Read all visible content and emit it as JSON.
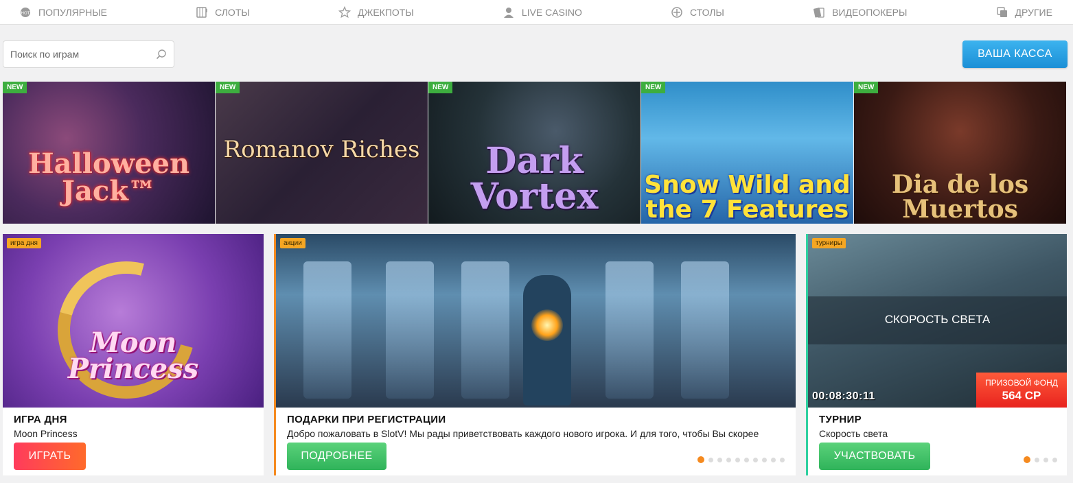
{
  "nav": {
    "items": [
      {
        "label": "ПОПУЛЯРНЫЕ",
        "icon": "hot-icon"
      },
      {
        "label": "СЛОТЫ",
        "icon": "slots-icon"
      },
      {
        "label": "ДЖЕКПОТЫ",
        "icon": "star-icon"
      },
      {
        "label": "LIVE CASINO",
        "icon": "dealer-icon"
      },
      {
        "label": "СТОЛЫ",
        "icon": "chip-icon"
      },
      {
        "label": "ВИДЕОПОКЕРЫ",
        "icon": "cards-icon"
      },
      {
        "label": "ДРУГИЕ",
        "icon": "other-icon"
      }
    ]
  },
  "search": {
    "placeholder": "Поиск по играм"
  },
  "kassa": {
    "label": "ВАША КАССА"
  },
  "games": [
    {
      "badge": "NEW",
      "title": "Halloween Jack™"
    },
    {
      "badge": "NEW",
      "title": "Romanov Riches"
    },
    {
      "badge": "NEW",
      "title": "Dark Vortex"
    },
    {
      "badge": "NEW",
      "title": "Snow Wild and the 7 Features"
    },
    {
      "badge": "NEW",
      "title": "Dia de los Muertos"
    }
  ],
  "game_of_day": {
    "tag": "игра дня",
    "image_title": "Moon Princess",
    "title": "ИГРА ДНЯ",
    "subtitle": "Moon Princess",
    "button": "ИГРАТЬ"
  },
  "promo": {
    "tag": "акции",
    "title": "ПОДАРКИ ПРИ РЕГИСТРАЦИИ",
    "subtitle": "Добро пожаловать в SlotV! Мы рады приветствовать каждого нового игрока. И для того, чтобы Вы скорее",
    "button": "ПОДРОБНЕЕ",
    "dots_total": 10,
    "dots_active": 0
  },
  "tournament": {
    "tag": "турниры",
    "overlay_title": "СКОРОСТЬ СВЕТА",
    "timer": "00:08:30:11",
    "prize_label": "ПРИЗОВОЙ ФОНД",
    "prize_value": "564 СР",
    "title": "ТУРНИР",
    "subtitle": "Скорость света",
    "button": "УЧАСТВОВАТЬ",
    "dots_total": 4,
    "dots_active": 0
  },
  "colors": {
    "accent_blue": "#1b8fd6",
    "accent_orange": "#f58a1f",
    "new_badge": "#3dae3f",
    "play_red": "#ff3b5c",
    "green_button": "#2fb35a"
  }
}
